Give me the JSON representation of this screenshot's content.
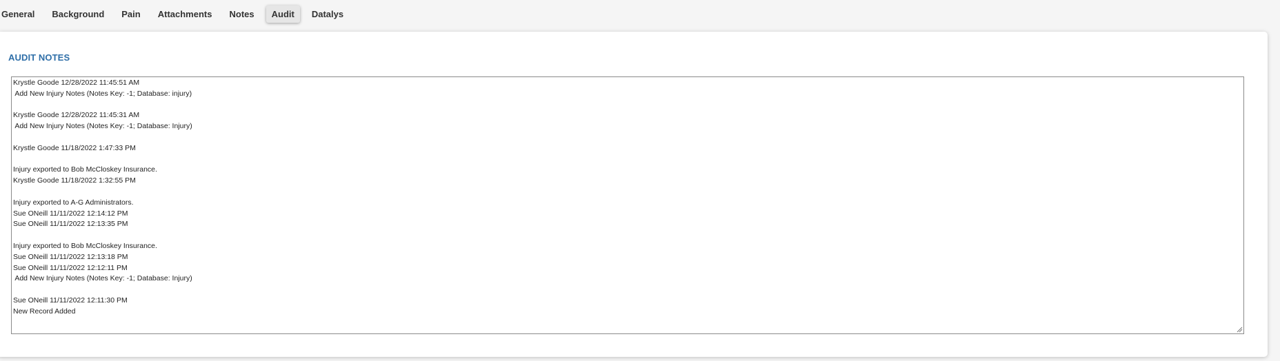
{
  "tabs": [
    {
      "label": "General",
      "active": false
    },
    {
      "label": "Background",
      "active": false
    },
    {
      "label": "Pain",
      "active": false
    },
    {
      "label": "Attachments",
      "active": false
    },
    {
      "label": "Notes",
      "active": false
    },
    {
      "label": "Audit",
      "active": true
    },
    {
      "label": "Datalys",
      "active": false
    }
  ],
  "section": {
    "title": "AUDIT NOTES"
  },
  "audit_notes": {
    "lines": [
      "Krystle Goode 12/28/2022 11:45:51 AM",
      " Add New Injury Notes (Notes Key: -1; Database: injury)",
      "",
      "Krystle Goode 12/28/2022 11:45:31 AM",
      " Add New Injury Notes (Notes Key: -1; Database: Injury)",
      "",
      "Krystle Goode 11/18/2022 1:47:33 PM",
      "",
      "Injury exported to Bob McCloskey Insurance.",
      "Krystle Goode 11/18/2022 1:32:55 PM",
      "",
      "Injury exported to A-G Administrators.",
      "Sue ONeill 11/11/2022 12:14:12 PM",
      "Sue ONeill 11/11/2022 12:13:35 PM",
      "",
      "Injury exported to Bob McCloskey Insurance.",
      "Sue ONeill 11/11/2022 12:13:18 PM",
      "Sue ONeill 11/11/2022 12:12:11 PM",
      " Add New Injury Notes (Notes Key: -1; Database: Injury)",
      "",
      "Sue ONeill 11/11/2022 12:11:30 PM",
      "New Record Added"
    ]
  },
  "colors": {
    "accent": "#2f6fa8",
    "page_background": "#f5f5f5",
    "panel_background": "#ffffff",
    "active_tab": "#e6e6e6"
  },
  "icons": {
    "resize": "resize-grip-icon"
  }
}
